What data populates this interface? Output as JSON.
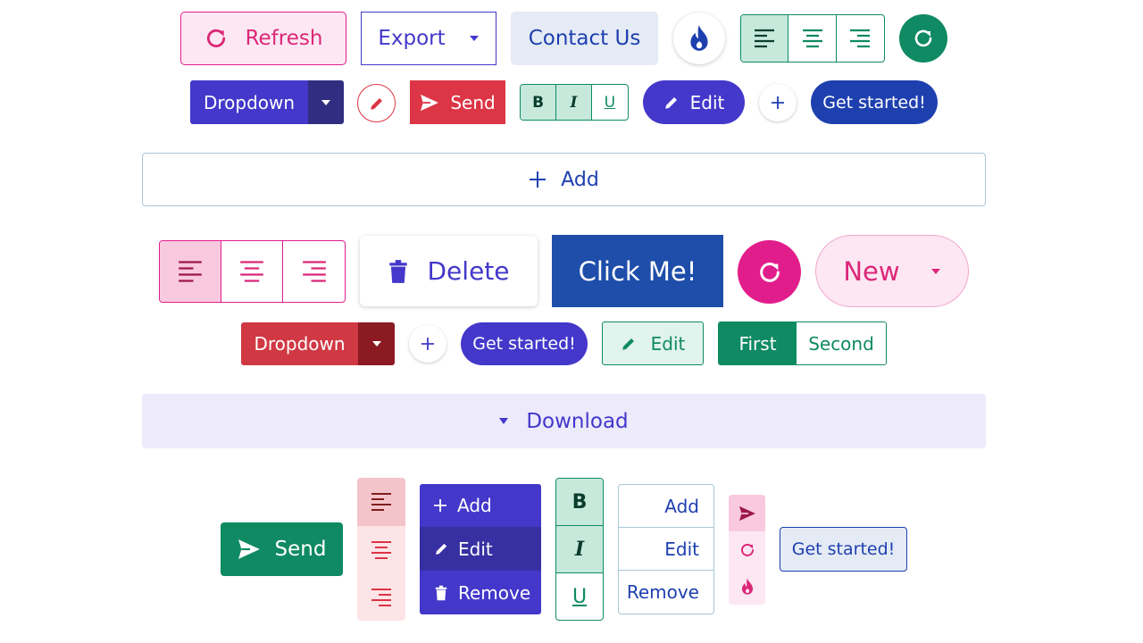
{
  "colors": {
    "pink": "#e11d8c",
    "pink_light": "#fce7f3",
    "pink_active": "#f9c9e0",
    "indigo": "#4338ca",
    "indigo_dark": "#312e81",
    "blue": "#1d4ed8",
    "navy": "#1e40af",
    "green": "#0f8a63",
    "green_light": "#c6e9dc",
    "red": "#dc3545",
    "red_dark": "#8b1a22",
    "rose_light": "#fde4e7",
    "lavender": "#eceafb",
    "slate_light": "#e5ebf5"
  },
  "row1": {
    "refresh_label": "Refresh",
    "export_label": "Export",
    "contact_label": "Contact Us"
  },
  "row2": {
    "dropdown_label": "Dropdown",
    "send_label": "Send",
    "bold_label": "B",
    "italic_label": "I",
    "underline_label": "U",
    "edit_label": "Edit",
    "get_started_label": "Get started!"
  },
  "add_bar": {
    "label": "Add"
  },
  "row3": {
    "delete_label": "Delete",
    "click_me_label": "Click Me!",
    "new_label": "New"
  },
  "row4": {
    "dropdown_label": "Dropdown",
    "get_started_label": "Get started!",
    "edit_label": "Edit",
    "first_label": "First",
    "second_label": "Second"
  },
  "download_bar": {
    "label": "Download"
  },
  "row5": {
    "send_label": "Send",
    "menu": {
      "add": "Add",
      "edit": "Edit",
      "remove": "Remove"
    },
    "format": {
      "bold": "B",
      "italic": "I",
      "underline": "U"
    },
    "list": {
      "add": "Add",
      "edit": "Edit",
      "remove": "Remove"
    },
    "get_started_label": "Get started!"
  }
}
